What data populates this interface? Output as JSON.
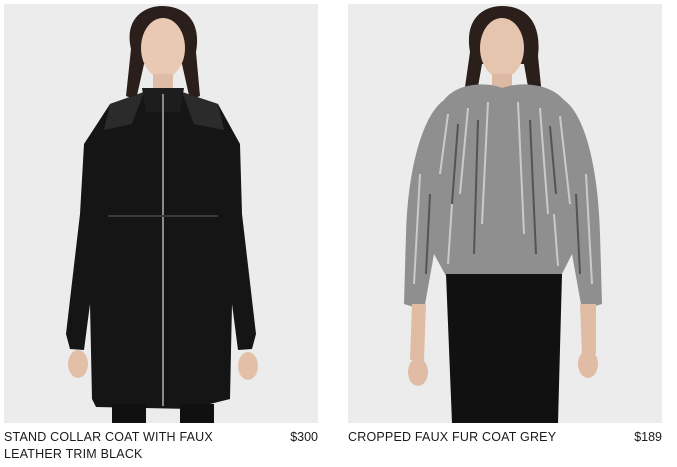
{
  "products": [
    {
      "name": "STAND COLLAR COAT WITH FAUX LEATHER TRIM BLACK",
      "price": "$300",
      "image_subject": "model-in-black-coat"
    },
    {
      "name": "CROPPED FAUX FUR COAT GREY",
      "price": "$189",
      "image_subject": "model-in-grey-fur-coat"
    }
  ],
  "colors": {
    "background": "#ffffff",
    "photo_bg": "#ececec",
    "text": "#1a1a1a"
  }
}
